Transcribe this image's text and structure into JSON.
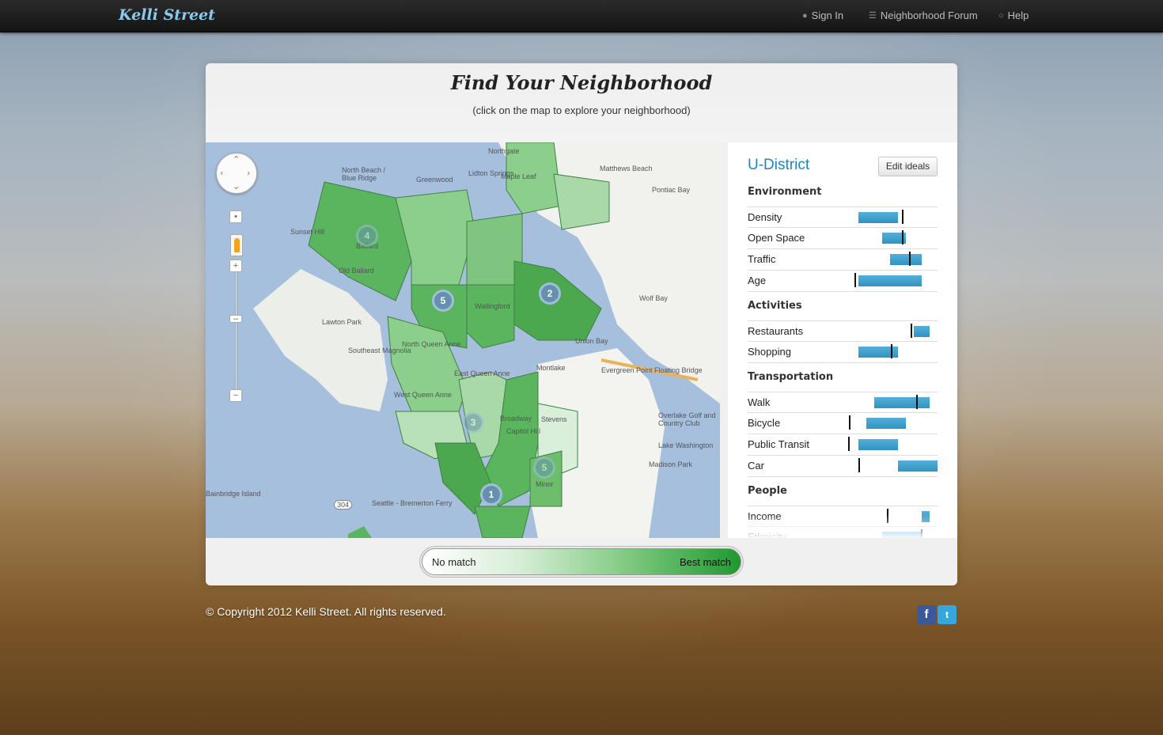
{
  "brand": "Kelli Street",
  "nav": [
    {
      "label": "Sign In",
      "icon": "person-icon"
    },
    {
      "label": "Neighborhood Forum",
      "icon": "list-icon"
    },
    {
      "label": "Help",
      "icon": "help-icon"
    }
  ],
  "header": {
    "title": "Find Your Neighborhood",
    "subtitle": "(click on the map to explore your neighborhood)"
  },
  "map": {
    "labels": [
      "Sunset Hill",
      "Old Ballard",
      "Ballard",
      "Lawton Park",
      "Southeast Magnolia",
      "North Queen Anne",
      "West Queen Anne",
      "East Queen Anne",
      "Wallingford",
      "Union Bay",
      "Evergreen Point Floating Bridge",
      "Montlake",
      "Broadway",
      "Capitol Hill",
      "Stevens",
      "Minor",
      "Madison Park",
      "Pontiac Bay",
      "Matthews Beach",
      "Seattle - Bremerton Ferry",
      "Bainbridge Island",
      "304",
      "Lake Washington",
      "Overlake Golf and Country Club",
      "Wolf Bay",
      "Northgate",
      "Greenwood",
      "Maple Leaf",
      "Lidton Springs",
      "North Beach / Blue Ridge"
    ],
    "clusters": [
      "4",
      "5",
      "2",
      "3",
      "5",
      "1"
    ]
  },
  "panel": {
    "neighborhood": "U-District",
    "edit_label": "Edit ideals",
    "groups": [
      {
        "title": "Environment",
        "items": [
          {
            "label": "Density",
            "bar": [
              0.0,
              0.5
            ],
            "ideal": 0.55
          },
          {
            "label": "Open Space",
            "bar": [
              0.3,
              0.6
            ],
            "ideal": 0.55
          },
          {
            "label": "Traffic",
            "bar": [
              0.4,
              0.8
            ],
            "ideal": 0.64
          },
          {
            "label": "Age",
            "bar": [
              0.0,
              0.8
            ],
            "ideal": -0.05
          }
        ]
      },
      {
        "title": "Activities",
        "items": [
          {
            "label": "Restaurants",
            "bar": [
              0.7,
              0.9
            ],
            "ideal": 0.66
          },
          {
            "label": "Shopping",
            "bar": [
              0.0,
              0.5
            ],
            "ideal": 0.41
          }
        ]
      },
      {
        "title": "Transportation",
        "items": [
          {
            "label": "Walk",
            "bar": [
              0.2,
              0.9
            ],
            "ideal": 0.73
          },
          {
            "label": "Bicycle",
            "bar": [
              0.1,
              0.6
            ],
            "ideal": -0.12
          },
          {
            "label": "Public Transit",
            "bar": [
              0.0,
              0.5
            ],
            "ideal": -0.13
          },
          {
            "label": "Car",
            "bar": [
              0.5,
              1.0
            ],
            "ideal": 0.0
          }
        ]
      },
      {
        "title": "People",
        "items": [
          {
            "label": "Income",
            "bar": [
              0.8,
              0.9
            ],
            "ideal": 0.36
          },
          {
            "label": "Ethnicity",
            "bar": [
              0.3,
              0.8
            ],
            "ideal": 0.79
          }
        ]
      }
    ]
  },
  "legend": {
    "low": "No match",
    "high": "Best match"
  },
  "footer": "© Copyright 2012 Kelli Street. All rights reserved.",
  "social": [
    {
      "name": "facebook",
      "glyph": "f"
    },
    {
      "name": "twitter",
      "glyph": "t"
    }
  ]
}
